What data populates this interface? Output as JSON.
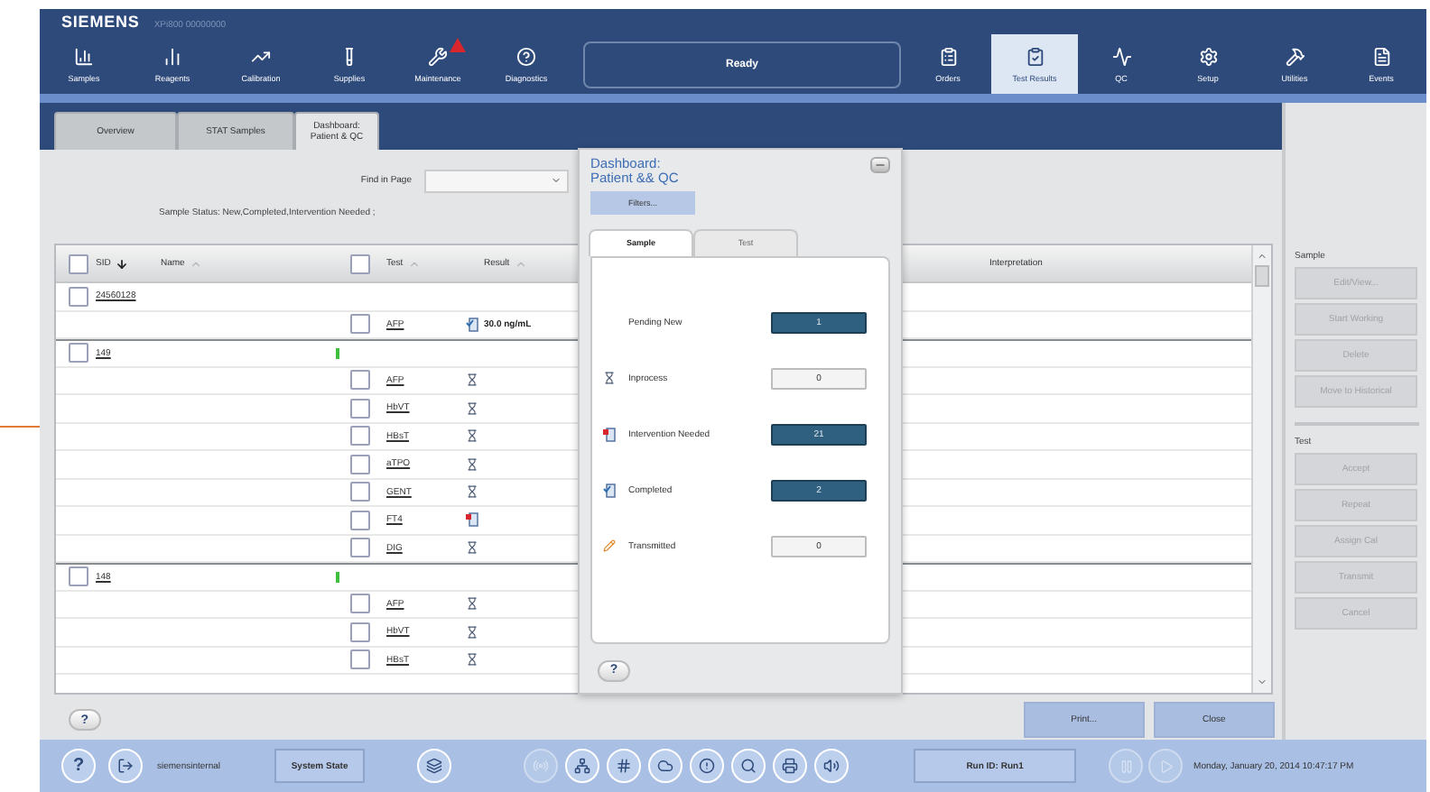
{
  "header": {
    "brand": "SIEMENS",
    "instrument": "XPi800 00000000",
    "status": "Ready",
    "nav_left": [
      {
        "label": "Samples",
        "alert": false
      },
      {
        "label": "Reagents",
        "alert": false
      },
      {
        "label": "Calibration",
        "alert": false
      },
      {
        "label": "Supplies",
        "alert": false
      },
      {
        "label": "Maintenance",
        "alert": true
      },
      {
        "label": "Diagnostics",
        "alert": false
      }
    ],
    "nav_right": [
      {
        "label": "Orders",
        "selected": false
      },
      {
        "label": "Test Results",
        "selected": true
      },
      {
        "label": "QC",
        "selected": false
      },
      {
        "label": "Setup",
        "selected": false
      },
      {
        "label": "Utilities",
        "selected": false
      },
      {
        "label": "Events",
        "selected": false
      }
    ]
  },
  "tabs": [
    {
      "lines": [
        "Overview"
      ],
      "selected": false
    },
    {
      "lines": [
        "STAT Samples"
      ],
      "selected": false
    },
    {
      "lines": [
        "Dashboard:",
        "Patient & QC"
      ],
      "selected": true
    }
  ],
  "find": {
    "label": "Find in Page"
  },
  "filter_summary": "Sample Status: New,Completed,Intervention Needed ;",
  "table": {
    "sample_select_all": {
      "checked": false
    },
    "test_select_all": {
      "checked": false
    },
    "columns": [
      {
        "label": "SID",
        "sorted": true
      },
      {
        "label": "Name",
        "sorted": false
      },
      {
        "label": "Test",
        "sorted": false
      },
      {
        "label": "Result",
        "sorted": false
      },
      {
        "label": "Interpretation"
      }
    ],
    "samples": [
      {
        "sid": "24560128",
        "checked": false,
        "indicator": false,
        "tests": [
          {
            "name": "AFP",
            "checked": false,
            "kind": "completed",
            "result": "30.0 ng/mL"
          }
        ]
      },
      {
        "sid": "149",
        "checked": false,
        "indicator": true,
        "tests": [
          {
            "name": "AFP",
            "checked": false,
            "kind": "inprocess"
          },
          {
            "name": "HbVT",
            "checked": false,
            "kind": "inprocess"
          },
          {
            "name": "HBsT",
            "checked": false,
            "kind": "inprocess"
          },
          {
            "name": "aTPO",
            "checked": false,
            "kind": "inprocess"
          },
          {
            "name": "GENT",
            "checked": false,
            "kind": "inprocess"
          },
          {
            "name": "FT4",
            "checked": false,
            "kind": "intervention"
          },
          {
            "name": "DIG",
            "checked": false,
            "kind": "inprocess"
          }
        ]
      },
      {
        "sid": "148",
        "checked": false,
        "indicator": true,
        "tests": [
          {
            "name": "AFP",
            "checked": false,
            "kind": "inprocess"
          },
          {
            "name": "HbVT",
            "checked": false,
            "kind": "inprocess"
          },
          {
            "name": "HBsT",
            "checked": false,
            "kind": "inprocess"
          }
        ]
      }
    ]
  },
  "dialog": {
    "title_lines": [
      "Dashboard:",
      "Patient && QC"
    ],
    "filters_button": "Filters...",
    "tabs": [
      {
        "label": "Sample",
        "selected": true
      },
      {
        "label": "Test",
        "selected": false
      }
    ],
    "rows": [
      {
        "label": "Pending New",
        "kind": "none",
        "count": "1",
        "highlighted": true
      },
      {
        "label": "Inprocess",
        "kind": "inprocess",
        "count": "0",
        "highlighted": false
      },
      {
        "label": "Intervention Needed",
        "kind": "intervention",
        "count": "21",
        "highlighted": true
      },
      {
        "label": "Completed",
        "kind": "completed",
        "count": "2",
        "highlighted": true
      },
      {
        "label": "Transmitted",
        "kind": "transmitted",
        "count": "0",
        "highlighted": false
      }
    ],
    "help": "?"
  },
  "content_help": "?",
  "print_button": "Print...",
  "close_button": "Close",
  "side_panel": {
    "sections": [
      {
        "heading": "Sample",
        "buttons": [
          {
            "label": "Edit/View...",
            "disabled": true
          },
          {
            "label": "Start Working",
            "disabled": true
          },
          {
            "label": "Delete",
            "disabled": true
          },
          {
            "label": "Move to Historical",
            "disabled": true
          }
        ]
      },
      {
        "heading": "Test",
        "buttons": [
          {
            "label": "Accept",
            "disabled": true
          },
          {
            "label": "Repeat",
            "disabled": true
          },
          {
            "label": "Assign Cal",
            "disabled": true
          },
          {
            "label": "Transmit",
            "disabled": true
          },
          {
            "label": "Cancel",
            "disabled": true
          }
        ]
      }
    ]
  },
  "footer": {
    "help": "?",
    "user": "siemensinternal",
    "system_state": "System State",
    "run_id": "Run ID: Run1",
    "datetime": "Monday, January 20, 2014 10:47:17 PM"
  }
}
